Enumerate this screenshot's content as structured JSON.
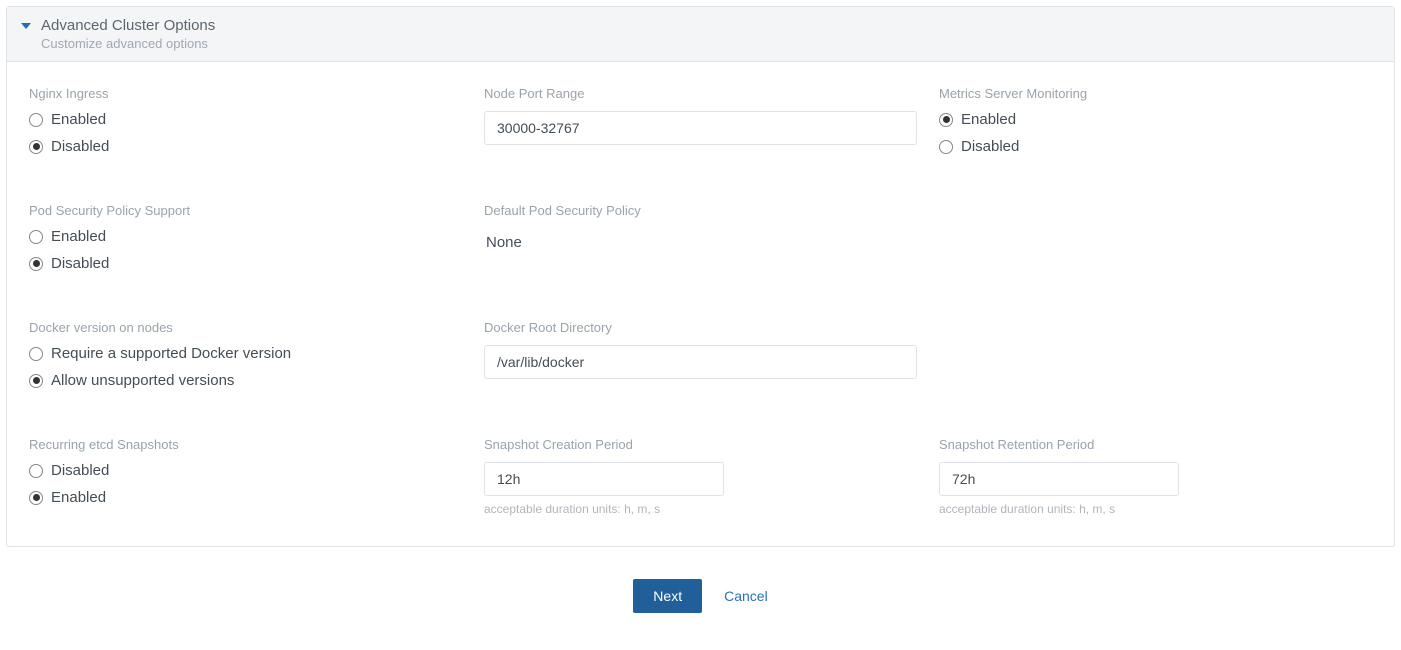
{
  "header": {
    "title": "Advanced Cluster Options",
    "subtitle": "Customize advanced options"
  },
  "fields": {
    "nginx_ingress": {
      "label": "Nginx Ingress",
      "options": {
        "enabled": "Enabled",
        "disabled": "Disabled"
      },
      "selected": "disabled"
    },
    "node_port_range": {
      "label": "Node Port Range",
      "value": "30000-32767"
    },
    "metrics_server": {
      "label": "Metrics Server Monitoring",
      "options": {
        "enabled": "Enabled",
        "disabled": "Disabled"
      },
      "selected": "enabled"
    },
    "pod_security_policy": {
      "label": "Pod Security Policy Support",
      "options": {
        "enabled": "Enabled",
        "disabled": "Disabled"
      },
      "selected": "disabled"
    },
    "default_psp": {
      "label": "Default Pod Security Policy",
      "value": "None"
    },
    "docker_version": {
      "label": "Docker version on nodes",
      "options": {
        "require": "Require a supported Docker version",
        "allow": "Allow unsupported versions"
      },
      "selected": "allow"
    },
    "docker_root": {
      "label": "Docker Root Directory",
      "value": "/var/lib/docker"
    },
    "etcd_snapshots": {
      "label": "Recurring etcd Snapshots",
      "options": {
        "disabled": "Disabled",
        "enabled": "Enabled"
      },
      "selected": "enabled"
    },
    "snapshot_creation": {
      "label": "Snapshot Creation Period",
      "value": "12h",
      "hint": "acceptable duration units: h, m, s"
    },
    "snapshot_retention": {
      "label": "Snapshot Retention Period",
      "value": "72h",
      "hint": "acceptable duration units: h, m, s"
    }
  },
  "footer": {
    "next": "Next",
    "cancel": "Cancel"
  }
}
